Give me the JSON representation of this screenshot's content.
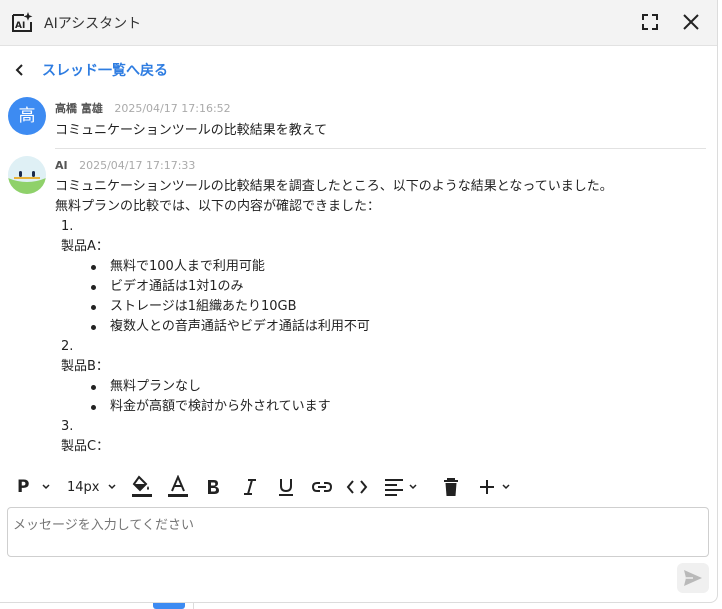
{
  "header": {
    "title": "AIアシスタント",
    "icon": "ai-sparkle-icon",
    "expand_icon": "expand-icon",
    "close_icon": "close-icon"
  },
  "back": {
    "label": "スレッド一覧へ戻る"
  },
  "messages": [
    {
      "author": "高橋 富雄",
      "timestamp": "2025/04/17 17:16:52",
      "avatar_text": "高",
      "text": "コミュニケーションツールの比較結果を教えて"
    },
    {
      "author": "AI",
      "timestamp": "2025/04/17 17:17:33",
      "intro": "コミュニケーションツールの比較結果を調査したところ、以下のような結果となっていました。",
      "lead": "無料プランの比較では、以下の内容が確認できました：",
      "items": [
        {
          "number": "1.",
          "product": "製品A：",
          "bullets": [
            "無料で100人まで利用可能",
            "ビデオ通話は1対1のみ",
            "ストレージは1組織あたり10GB",
            "複数人との音声通話やビデオ通話は利用不可"
          ]
        },
        {
          "number": "2.",
          "product": "製品B：",
          "bullets": [
            "無料プランなし",
            "料金が高額で検討から外されています"
          ]
        },
        {
          "number": "3.",
          "product": "製品C：",
          "bullets": []
        }
      ]
    }
  ],
  "toolbar": {
    "paragraph_label": "P",
    "font_size": "14px"
  },
  "composer": {
    "placeholder": "メッセージを入力してください"
  },
  "colors": {
    "accent": "#2f7de1",
    "user_avatar": "#3d8bf2"
  }
}
